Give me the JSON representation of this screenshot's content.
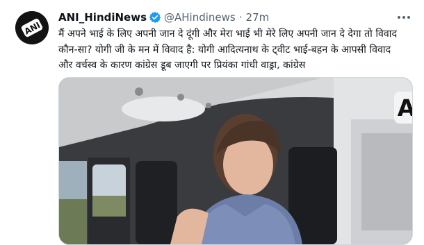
{
  "tweet": {
    "display_name": "ANI_HindiNews",
    "handle": "@AHindinews",
    "separator": "·",
    "time": "27m",
    "avatar_logo_text": "ANI",
    "text": "मैं अपने भाई के लिए अपनी जान दे दूंगी और मेरा भाई भी मेरे लिए अपनी जान दे देगा तो विवाद कौन-सा? योगी जी के मन में विवाद है: योगी आदित्यनाथ के ट्वीट भाई-बहन के आपसी विवाद और वर्चस्व के कारण कांग्रेस डूब जाएगी पर प्रियंका गांधी वाड्रा, कांग्रेस",
    "media_watermark": "ANI"
  },
  "icons": {
    "verified": "verified-badge-icon",
    "more": "more-options-icon"
  },
  "colors": {
    "verified_blue": "#1d9bf0",
    "secondary_text": "#536471",
    "border": "#cfd9de"
  }
}
